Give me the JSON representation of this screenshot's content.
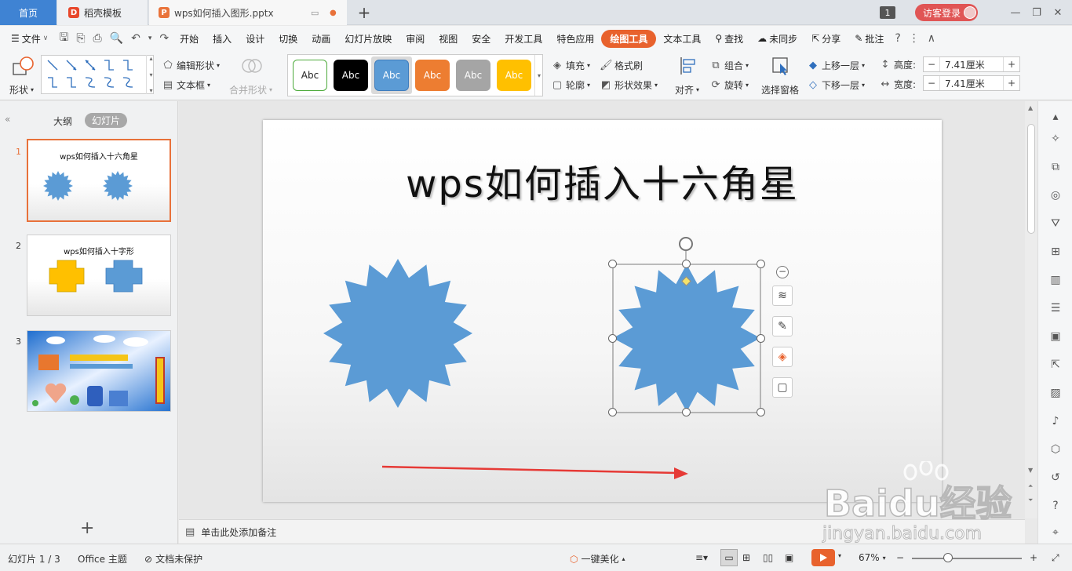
{
  "tabs": {
    "home": "首页",
    "template": "稻壳模板",
    "document": "wps如何插入图形.pptx",
    "window_count": "1",
    "login": "访客登录"
  },
  "menu": {
    "file": "文件",
    "items": [
      "开始",
      "插入",
      "设计",
      "切换",
      "动画",
      "幻灯片放映",
      "审阅",
      "视图",
      "安全",
      "开发工具",
      "特色应用"
    ],
    "active": "绘图工具",
    "text_tool": "文本工具",
    "search": "查找",
    "sync": "未同步",
    "share": "分享",
    "comment": "批注"
  },
  "ribbon": {
    "shape": "形状",
    "edit_shape": "编辑形状",
    "textbox": "文本框",
    "merge_shape": "合并形状",
    "styles": [
      "Abc",
      "Abc",
      "Abc",
      "Abc",
      "Abc",
      "Abc"
    ],
    "fill": "填充",
    "format_painter": "格式刷",
    "outline": "轮廓",
    "shape_effect": "形状效果",
    "align": "对齐",
    "group": "组合",
    "rotate": "旋转",
    "selection_pane": "选择窗格",
    "bring_forward": "上移一层",
    "send_backward": "下移一层",
    "height_label": "高度:",
    "height_value": "7.41厘米",
    "width_label": "宽度:",
    "width_value": "7.41厘米"
  },
  "left_panel": {
    "outline_tab": "大纲",
    "slides_tab": "幻灯片",
    "thumbs": [
      {
        "num": "1",
        "title": "wps如何插入十六角星"
      },
      {
        "num": "2",
        "title": "wps如何插入十字形"
      },
      {
        "num": "3",
        "title": ""
      }
    ],
    "add": "+"
  },
  "slide": {
    "title": "wps如何插入十六角星"
  },
  "notes": {
    "placeholder": "单击此处添加备注"
  },
  "status": {
    "slide_pos": "幻灯片 1 / 3",
    "theme": "Office 主题",
    "protect": "文档未保护",
    "beautify": "一键美化",
    "zoom": "67%"
  },
  "watermark": {
    "brand": "Baidu经验",
    "url": "jingyan.baidu.com"
  },
  "colors": {
    "accent_orange": "#e8622d",
    "shape_blue": "#5b9bd5",
    "arrow_red": "#e63a36"
  }
}
